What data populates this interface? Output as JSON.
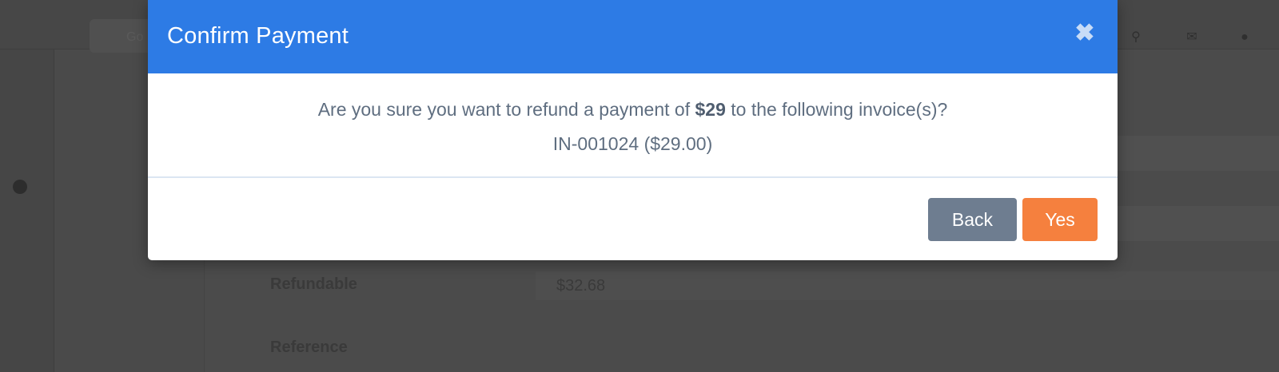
{
  "background": {
    "search_text": "Go",
    "field_labels": [
      "Refundable",
      "Reference"
    ],
    "refundable_value": "$32.68",
    "top_icons": [
      "search-icon",
      "mail-icon",
      "user-icon"
    ]
  },
  "modal": {
    "title": "Confirm Payment",
    "close_icon": "close-icon",
    "message_prefix": "Are you sure you want to refund a payment of ",
    "amount": "$29",
    "message_suffix": " to the following invoice(s)?",
    "invoice_line": "IN-001024 ($29.00)",
    "buttons": {
      "back": "Back",
      "yes": "Yes"
    },
    "colors": {
      "header": "#2d7be5",
      "back_button": "#6e7d90",
      "yes_button": "#f5803e"
    }
  }
}
